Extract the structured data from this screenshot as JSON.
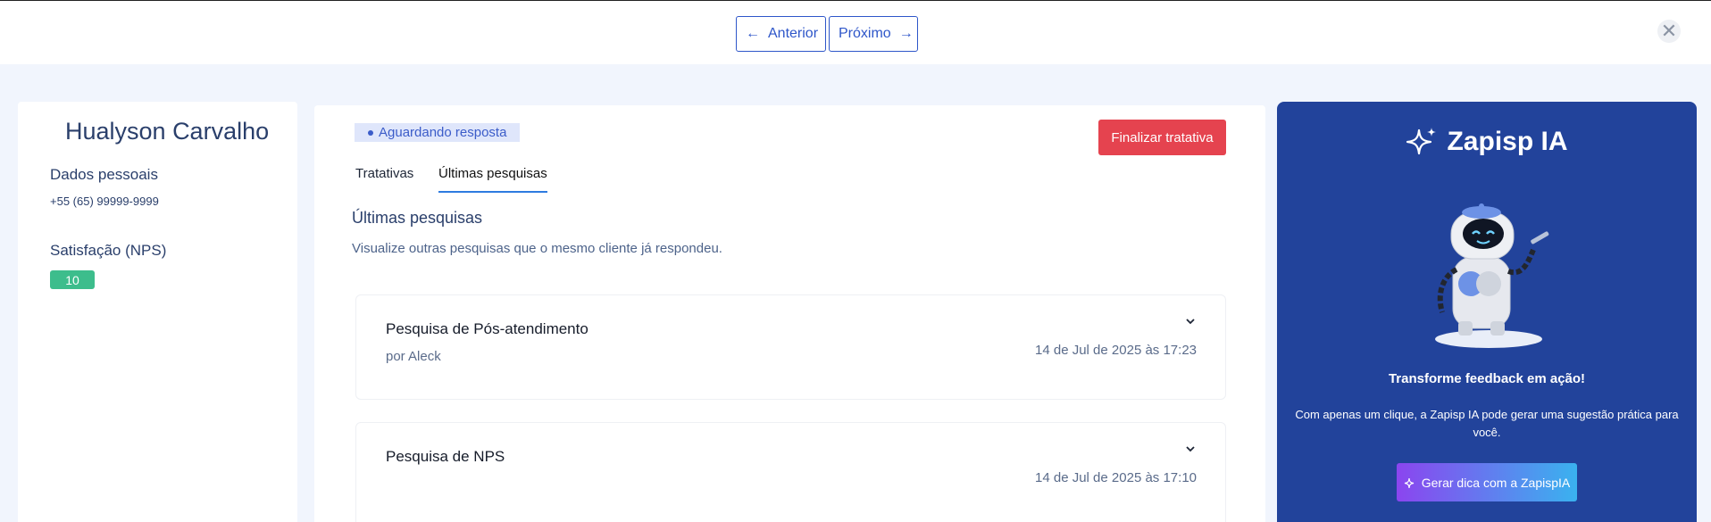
{
  "nav": {
    "prev_label": "Anterior",
    "next_label": "Próximo",
    "prev_icon": "arrow-left-icon",
    "next_icon": "arrow-right-icon",
    "close_icon": "close-icon"
  },
  "client": {
    "name": "Hualyson Carvalho",
    "personal_label": "Dados pessoais",
    "phone": "+55 (65) 99999-9999",
    "nps_label": "Satisfação (NPS)",
    "nps_value": "10"
  },
  "detail": {
    "status": "Aguardando resposta",
    "finalize_label": "Finalizar tratativa",
    "tabs": [
      {
        "label": "Tratativas",
        "active": false
      },
      {
        "label": "Últimas pesquisas",
        "active": true
      }
    ],
    "section_title": "Últimas pesquisas",
    "section_desc": "Visualize outras pesquisas que o mesmo cliente já respondeu.",
    "surveys": [
      {
        "title": "Pesquisa de Pós-atendimento",
        "author": "por Aleck",
        "date": "14 de Jul de 2025 às 17:23"
      },
      {
        "title": "Pesquisa de NPS",
        "author": "",
        "date": "14 de Jul de 2025 às 17:10"
      }
    ]
  },
  "ai": {
    "title": "Zapisp IA",
    "heading": "Transforme feedback em ação!",
    "text": "Com apenas um clique, a Zapisp IA pode gerar uma sugestão prática para você.",
    "button_label": "Gerar dica com a ZapispIA",
    "colors": {
      "panel": "#22439b",
      "button_start": "#8b45ef",
      "button_end": "#3ab2ef"
    }
  },
  "colors": {
    "accent": "#2e56c9",
    "danger": "#e5434f",
    "success": "#3dbd8c"
  }
}
